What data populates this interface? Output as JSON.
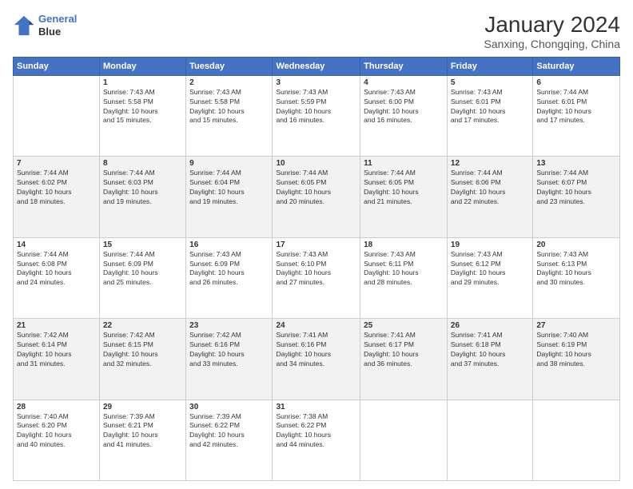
{
  "header": {
    "logo_line1": "General",
    "logo_line2": "Blue",
    "main_title": "January 2024",
    "subtitle": "Sanxing, Chongqing, China"
  },
  "days_of_week": [
    "Sunday",
    "Monday",
    "Tuesday",
    "Wednesday",
    "Thursday",
    "Friday",
    "Saturday"
  ],
  "weeks": [
    [
      {
        "day": "",
        "info": ""
      },
      {
        "day": "1",
        "info": "Sunrise: 7:43 AM\nSunset: 5:58 PM\nDaylight: 10 hours\nand 15 minutes."
      },
      {
        "day": "2",
        "info": "Sunrise: 7:43 AM\nSunset: 5:58 PM\nDaylight: 10 hours\nand 15 minutes."
      },
      {
        "day": "3",
        "info": "Sunrise: 7:43 AM\nSunset: 5:59 PM\nDaylight: 10 hours\nand 16 minutes."
      },
      {
        "day": "4",
        "info": "Sunrise: 7:43 AM\nSunset: 6:00 PM\nDaylight: 10 hours\nand 16 minutes."
      },
      {
        "day": "5",
        "info": "Sunrise: 7:43 AM\nSunset: 6:01 PM\nDaylight: 10 hours\nand 17 minutes."
      },
      {
        "day": "6",
        "info": "Sunrise: 7:44 AM\nSunset: 6:01 PM\nDaylight: 10 hours\nand 17 minutes."
      }
    ],
    [
      {
        "day": "7",
        "info": "Sunrise: 7:44 AM\nSunset: 6:02 PM\nDaylight: 10 hours\nand 18 minutes."
      },
      {
        "day": "8",
        "info": "Sunrise: 7:44 AM\nSunset: 6:03 PM\nDaylight: 10 hours\nand 19 minutes."
      },
      {
        "day": "9",
        "info": "Sunrise: 7:44 AM\nSunset: 6:04 PM\nDaylight: 10 hours\nand 19 minutes."
      },
      {
        "day": "10",
        "info": "Sunrise: 7:44 AM\nSunset: 6:05 PM\nDaylight: 10 hours\nand 20 minutes."
      },
      {
        "day": "11",
        "info": "Sunrise: 7:44 AM\nSunset: 6:05 PM\nDaylight: 10 hours\nand 21 minutes."
      },
      {
        "day": "12",
        "info": "Sunrise: 7:44 AM\nSunset: 6:06 PM\nDaylight: 10 hours\nand 22 minutes."
      },
      {
        "day": "13",
        "info": "Sunrise: 7:44 AM\nSunset: 6:07 PM\nDaylight: 10 hours\nand 23 minutes."
      }
    ],
    [
      {
        "day": "14",
        "info": "Sunrise: 7:44 AM\nSunset: 6:08 PM\nDaylight: 10 hours\nand 24 minutes."
      },
      {
        "day": "15",
        "info": "Sunrise: 7:44 AM\nSunset: 6:09 PM\nDaylight: 10 hours\nand 25 minutes."
      },
      {
        "day": "16",
        "info": "Sunrise: 7:43 AM\nSunset: 6:09 PM\nDaylight: 10 hours\nand 26 minutes."
      },
      {
        "day": "17",
        "info": "Sunrise: 7:43 AM\nSunset: 6:10 PM\nDaylight: 10 hours\nand 27 minutes."
      },
      {
        "day": "18",
        "info": "Sunrise: 7:43 AM\nSunset: 6:11 PM\nDaylight: 10 hours\nand 28 minutes."
      },
      {
        "day": "19",
        "info": "Sunrise: 7:43 AM\nSunset: 6:12 PM\nDaylight: 10 hours\nand 29 minutes."
      },
      {
        "day": "20",
        "info": "Sunrise: 7:43 AM\nSunset: 6:13 PM\nDaylight: 10 hours\nand 30 minutes."
      }
    ],
    [
      {
        "day": "21",
        "info": "Sunrise: 7:42 AM\nSunset: 6:14 PM\nDaylight: 10 hours\nand 31 minutes."
      },
      {
        "day": "22",
        "info": "Sunrise: 7:42 AM\nSunset: 6:15 PM\nDaylight: 10 hours\nand 32 minutes."
      },
      {
        "day": "23",
        "info": "Sunrise: 7:42 AM\nSunset: 6:16 PM\nDaylight: 10 hours\nand 33 minutes."
      },
      {
        "day": "24",
        "info": "Sunrise: 7:41 AM\nSunset: 6:16 PM\nDaylight: 10 hours\nand 34 minutes."
      },
      {
        "day": "25",
        "info": "Sunrise: 7:41 AM\nSunset: 6:17 PM\nDaylight: 10 hours\nand 36 minutes."
      },
      {
        "day": "26",
        "info": "Sunrise: 7:41 AM\nSunset: 6:18 PM\nDaylight: 10 hours\nand 37 minutes."
      },
      {
        "day": "27",
        "info": "Sunrise: 7:40 AM\nSunset: 6:19 PM\nDaylight: 10 hours\nand 38 minutes."
      }
    ],
    [
      {
        "day": "28",
        "info": "Sunrise: 7:40 AM\nSunset: 6:20 PM\nDaylight: 10 hours\nand 40 minutes."
      },
      {
        "day": "29",
        "info": "Sunrise: 7:39 AM\nSunset: 6:21 PM\nDaylight: 10 hours\nand 41 minutes."
      },
      {
        "day": "30",
        "info": "Sunrise: 7:39 AM\nSunset: 6:22 PM\nDaylight: 10 hours\nand 42 minutes."
      },
      {
        "day": "31",
        "info": "Sunrise: 7:38 AM\nSunset: 6:22 PM\nDaylight: 10 hours\nand 44 minutes."
      },
      {
        "day": "",
        "info": ""
      },
      {
        "day": "",
        "info": ""
      },
      {
        "day": "",
        "info": ""
      }
    ]
  ]
}
